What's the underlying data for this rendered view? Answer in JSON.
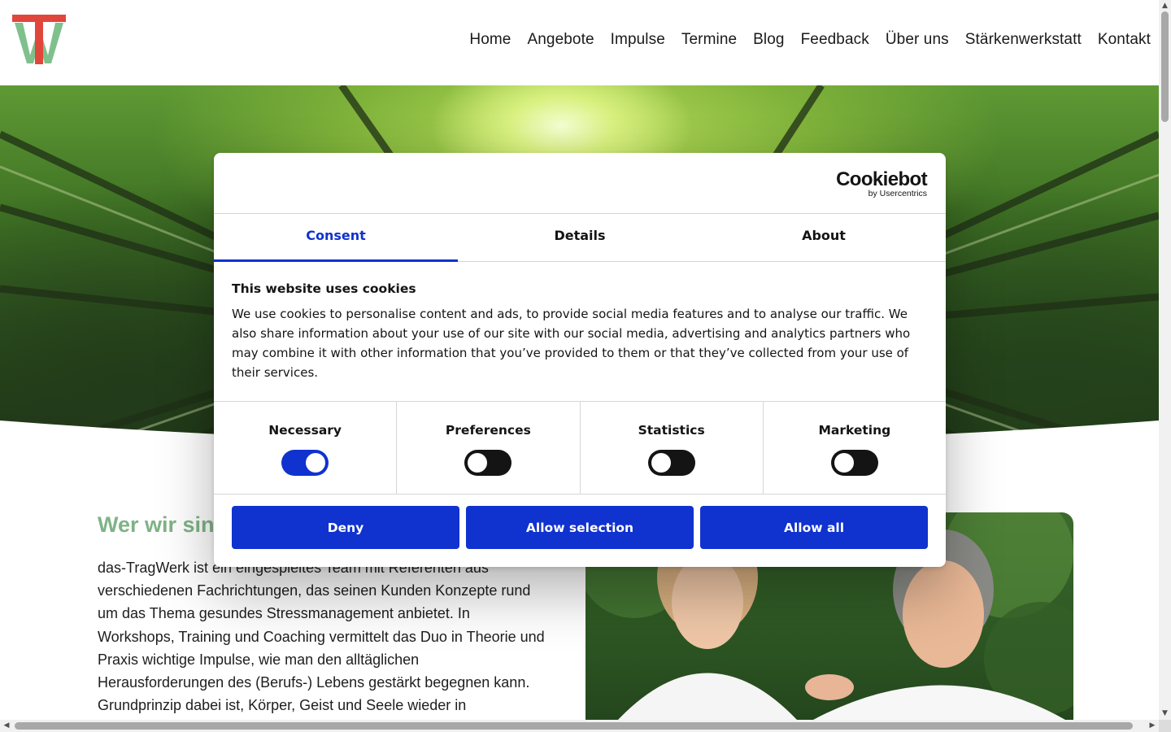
{
  "header": {
    "nav": [
      "Home",
      "Angebote",
      "Impulse",
      "Termine",
      "Blog",
      "Feedback",
      "Über uns",
      "Stärkenwerkstatt",
      "Kontakt"
    ]
  },
  "main": {
    "title": "Wer wir sind",
    "intro": "das-TragWerk ist ein eingespieltes Team mit Referenten aus verschiedenen Fachrichtungen, das seinen Kunden Konzepte rund um das Thema gesundes Stressmanagement anbietet. In Workshops, Training und Coaching vermittelt das Duo in Theorie und Praxis wichtige Impulse, wie man den alltäglichen Herausforderungen des (Berufs-) Lebens gestärkt begegnen kann. Grundprinzip dabei ist, Körper, Geist und Seele wieder in"
  },
  "cookie": {
    "brand": "Cookiebot",
    "brand_sub": "by Usercentrics",
    "tabs": [
      "Consent",
      "Details",
      "About"
    ],
    "active_tab": "Consent",
    "heading": "This website uses cookies",
    "body": "We use cookies to personalise content and ads, to provide social media features and to analyse our traffic. We also share information about your use of our site with our social media, advertising and analytics partners who may combine it with other information that you’ve provided to them or that they’ve collected from your use of their services.",
    "categories": [
      {
        "label": "Necessary",
        "enabled": true
      },
      {
        "label": "Preferences",
        "enabled": false
      },
      {
        "label": "Statistics",
        "enabled": false
      },
      {
        "label": "Marketing",
        "enabled": false
      }
    ],
    "buttons": {
      "deny": "Deny",
      "allow_selection": "Allow selection",
      "allow_all": "Allow all"
    }
  },
  "colors": {
    "accent": "#1032cf",
    "logo_red": "#e0463c",
    "logo_green": "#7fc08c",
    "title_green": "#7fb386"
  }
}
